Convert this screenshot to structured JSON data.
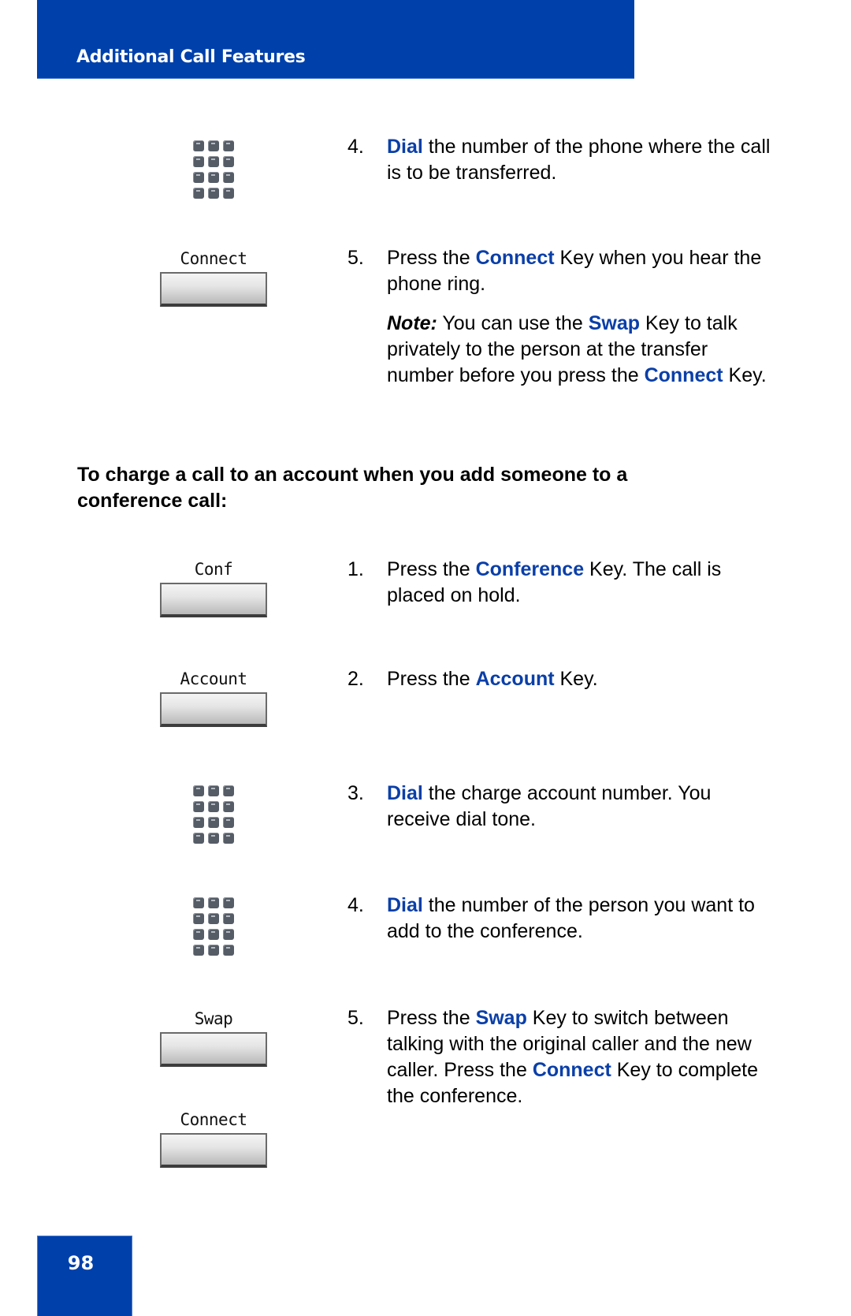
{
  "header": {
    "title": "Additional Call Features"
  },
  "footer": {
    "page_number": "98"
  },
  "transfer_steps": [
    {
      "number": "4.",
      "icon": "dialpad-icon",
      "parts": [
        {
          "text": "Dial",
          "hl": true
        },
        {
          "text": " the number of the phone where the call is to be transferred."
        }
      ]
    },
    {
      "number": "5.",
      "icon": "softkey",
      "key_label": "Connect",
      "parts": [
        {
          "text": "Press the "
        },
        {
          "text": "Connect",
          "hl": true
        },
        {
          "text": " Key when you hear the phone ring."
        }
      ],
      "note": [
        {
          "text": "Note:",
          "note": true
        },
        {
          "text": " You can use the "
        },
        {
          "text": "Swap",
          "hl": true
        },
        {
          "text": " Key to talk privately to the person at the transfer number before you press the "
        },
        {
          "text": "Connect",
          "hl": true
        },
        {
          "text": " Key."
        }
      ]
    }
  ],
  "section_heading": "To charge a call to an account when you add someone to a conference call:",
  "conference_steps": [
    {
      "number": "1.",
      "icon": "softkey",
      "key_label": "Conf",
      "parts": [
        {
          "text": "Press the "
        },
        {
          "text": "Conference",
          "hl": true
        },
        {
          "text": " Key. The call is placed on hold."
        }
      ]
    },
    {
      "number": "2.",
      "icon": "softkey",
      "key_label": "Account",
      "parts": [
        {
          "text": "Press the "
        },
        {
          "text": "Account",
          "hl": true
        },
        {
          "text": " Key."
        }
      ]
    },
    {
      "number": "3.",
      "icon": "dialpad-icon",
      "parts": [
        {
          "text": "Dial",
          "hl": true
        },
        {
          "text": " the charge account number. You receive dial tone."
        }
      ]
    },
    {
      "number": "4.",
      "icon": "dialpad-icon",
      "parts": [
        {
          "text": "Dial",
          "hl": true
        },
        {
          "text": " the number of the person you want to add to the conference."
        }
      ]
    },
    {
      "number": "5.",
      "icon": "softkey",
      "key_label": "Swap",
      "key_label_2": "Connect",
      "parts": [
        {
          "text": "Press the "
        },
        {
          "text": "Swap",
          "hl": true
        },
        {
          "text": " Key to switch between talking with the original caller and the new caller. Press the "
        },
        {
          "text": "Connect",
          "hl": true
        },
        {
          "text": " Key to complete the conference."
        }
      ]
    }
  ],
  "colors": {
    "brand_blue": "#0040ab",
    "highlight_blue": "#0a3fa8"
  }
}
